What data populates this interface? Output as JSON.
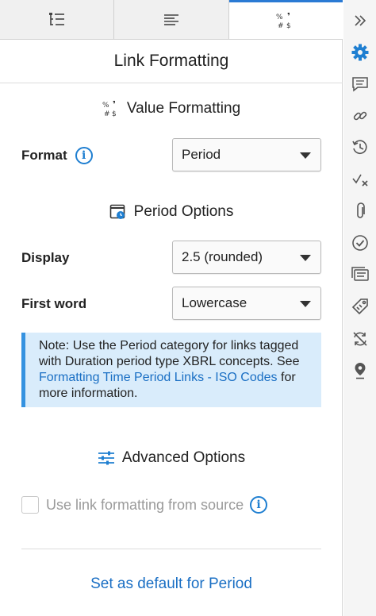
{
  "tabs": [
    {
      "name": "outline",
      "icon": "tree-list-icon",
      "active": false
    },
    {
      "name": "text",
      "icon": "text-lines-icon",
      "active": false
    },
    {
      "name": "formatting",
      "icon": "value-format-icon",
      "active": true
    }
  ],
  "title": "Link Formatting",
  "value_formatting": {
    "heading": "Value Formatting",
    "format_label": "Format",
    "format_value": "Period"
  },
  "period_options": {
    "heading": "Period Options",
    "display_label": "Display",
    "display_value": "2.5 (rounded)",
    "first_word_label": "First word",
    "first_word_value": "Lowercase"
  },
  "note": {
    "prefix": "Note: Use the Period category for links tagged with Duration period type XBRL concepts. See ",
    "link": "Formatting Time Period Links - ISO Codes",
    "suffix": " for more information."
  },
  "advanced": {
    "heading": "Advanced Options",
    "checkbox_label": "Use link formatting from source",
    "checked": false
  },
  "default_link": "Set as default for Period",
  "sidebar_icons": [
    "chevrons-right-icon",
    "gear-icon",
    "comment-icon",
    "link-icon",
    "history-icon",
    "check-cross-icon",
    "paperclip-icon",
    "check-circle-icon",
    "document-stack-icon",
    "tag-icon",
    "sync-off-icon",
    "location-pin-icon"
  ],
  "colors": {
    "accent": "#1f7fd1",
    "note_bg": "#d9ecfb",
    "link": "#1a6fc4"
  }
}
